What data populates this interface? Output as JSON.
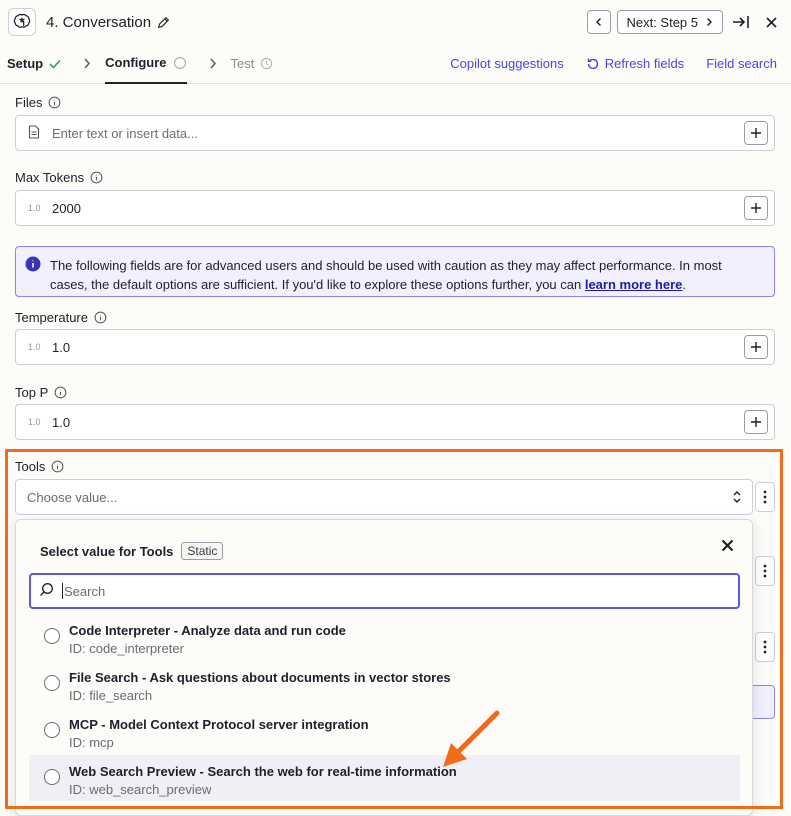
{
  "header": {
    "title": "4. Conversation",
    "next_label": "Next: Step 5"
  },
  "tabs": {
    "setup": "Setup",
    "configure": "Configure",
    "test": "Test",
    "copilot": "Copilot suggestions",
    "refresh": "Refresh fields",
    "field_search": "Field search"
  },
  "fields": {
    "files": {
      "label": "Files",
      "placeholder": "Enter text or insert data..."
    },
    "max_tokens": {
      "label": "Max Tokens",
      "prefix": "1.0",
      "value": "2000"
    },
    "temperature": {
      "label": "Temperature",
      "prefix": "1.0",
      "value": "1.0"
    },
    "top_p": {
      "label": "Top P",
      "prefix": "1.0",
      "value": "1.0"
    },
    "tools": {
      "label": "Tools",
      "placeholder": "Choose value..."
    }
  },
  "notice": {
    "text": "The following fields are for advanced users and should be used with caution as they may affect performance. In most cases, the default options are sufficient. If you'd like to explore these options further, you can ",
    "link": "learn more here",
    "end": "."
  },
  "dropdown": {
    "title": "Select value for Tools",
    "badge": "Static",
    "search_placeholder": "Search",
    "options": [
      {
        "label": "Code Interpreter - Analyze data and run code",
        "id": "ID: code_interpreter"
      },
      {
        "label": "File Search - Ask questions about documents in vector stores",
        "id": "ID: file_search"
      },
      {
        "label": "MCP - Model Context Protocol server integration",
        "id": "ID: mcp"
      },
      {
        "label": "Web Search Preview - Search the web for real-time information",
        "id": "ID: web_search_preview"
      }
    ]
  },
  "colors": {
    "accent": "#4d45d6",
    "annotation": "#f26a1b",
    "notice_bg": "#f1f0ff"
  }
}
